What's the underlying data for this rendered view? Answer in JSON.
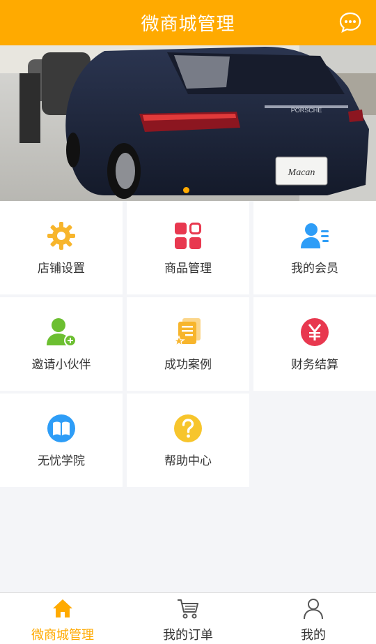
{
  "header": {
    "title": "微商城管理",
    "chat_icon": "chat-bubble-icon"
  },
  "banner": {
    "image_desc_icon": "banner-car-photo",
    "plate_text": "Macan",
    "brand_text": "PORSCHE"
  },
  "menu": {
    "items": [
      {
        "label": "店铺设置",
        "icon": "gear-icon",
        "color": "#f7b52c"
      },
      {
        "label": "商品管理",
        "icon": "grid-icon",
        "color": "#e8384f"
      },
      {
        "label": "我的会员",
        "icon": "member-icon",
        "color": "#2e9df7"
      },
      {
        "label": "邀请小伙伴",
        "icon": "add-user-icon",
        "color": "#6cbf31"
      },
      {
        "label": "成功案例",
        "icon": "case-icon",
        "color": "#f7b52c"
      },
      {
        "label": "财务结算",
        "icon": "yen-icon",
        "color": "#e8384f"
      },
      {
        "label": "无忧学院",
        "icon": "book-icon",
        "color": "#2e9df7"
      },
      {
        "label": "帮助中心",
        "icon": "help-icon",
        "color": "#f7c52c"
      }
    ]
  },
  "tabbar": {
    "items": [
      {
        "label": "微商城管理",
        "icon": "home-icon",
        "active": true
      },
      {
        "label": "我的订单",
        "icon": "cart-icon",
        "active": false
      },
      {
        "label": "我的",
        "icon": "user-icon",
        "active": false
      }
    ]
  },
  "colors": {
    "accent": "#ffaa00",
    "background": "#f4f5f8"
  }
}
